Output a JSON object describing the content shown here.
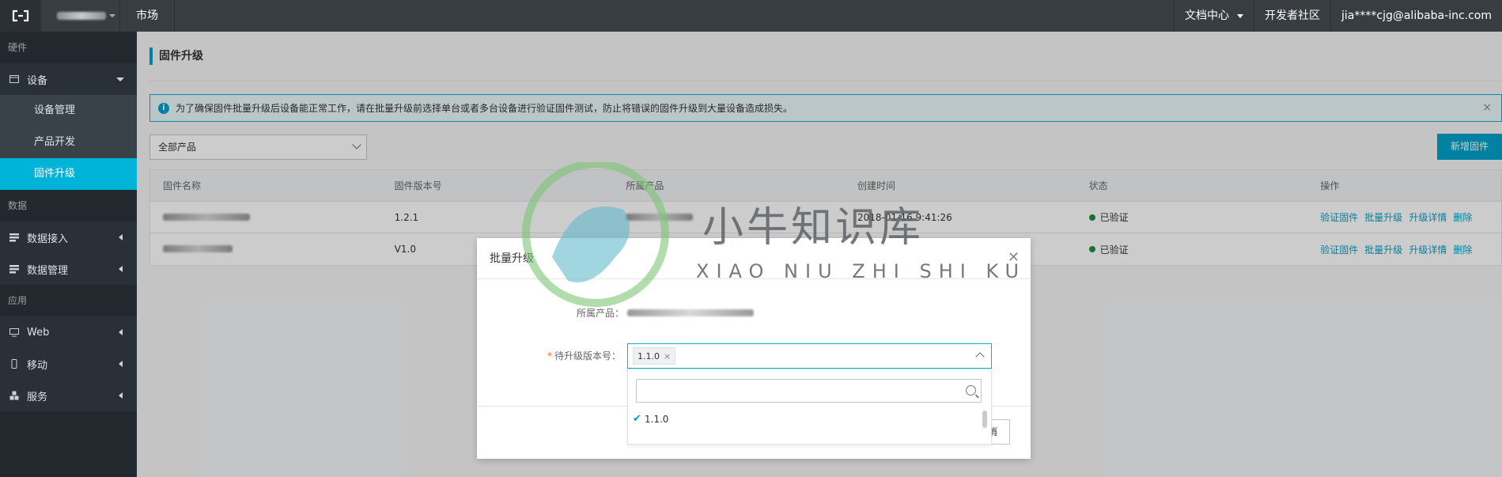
{
  "topbar": {
    "market": "市场",
    "docs": "文档中心",
    "community": "开发者社区",
    "account": "jia****cjg@alibaba-inc.com"
  },
  "sidebar": {
    "section_hardware": "硬件",
    "device": "设备",
    "device_mgmt": "设备管理",
    "product_dev": "产品开发",
    "firmware": "固件升级",
    "section_data": "数据",
    "data_access": "数据接入",
    "data_mgmt": "数据管理",
    "section_app": "应用",
    "web": "Web",
    "mobile": "移动",
    "service": "服务"
  },
  "page": {
    "title": "固件升级",
    "alert": "为了确保固件批量升级后设备能正常工作，请在批量升级前选择单台或者多台设备进行验证固件测试，防止将错误的固件升级到大量设备造成损失。",
    "product_filter": "全部产品",
    "new_button": "新增固件"
  },
  "table": {
    "headers": [
      "固件名称",
      "固件版本号",
      "所属产品",
      "创建时间",
      "状态",
      "操作"
    ],
    "rows": [
      {
        "version": "1.2.1",
        "created": "2018-01-16 9:41:26",
        "status": "已验证"
      },
      {
        "version": "V1.0",
        "created": "",
        "status": "已验证"
      }
    ],
    "actions": [
      "验证固件",
      "批量升级",
      "升级详情",
      "删除"
    ],
    "status_color": "#1e8e3e"
  },
  "modal": {
    "title": "批量升级",
    "product_label": "所属产品：",
    "version_label": "待升级版本号：",
    "selected_tag": "1.1.0",
    "option": "1.1.0",
    "cancel_tail": "消"
  },
  "watermark": {
    "text": "小牛知识库",
    "sub": "XIAO NIU ZHI SHI KU"
  },
  "colors": {
    "accent": "#00a2ca",
    "topbar": "#373d41",
    "sidebar": "#22282e"
  }
}
